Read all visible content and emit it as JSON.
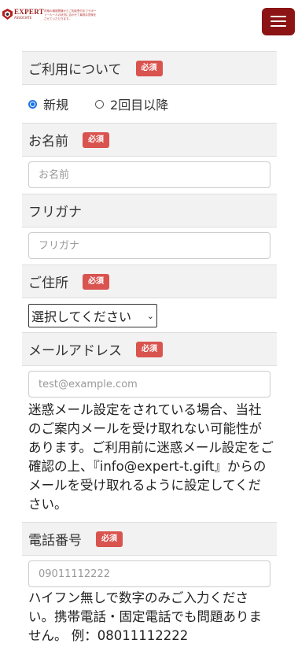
{
  "header": {
    "brand": "EXPERT",
    "brand_sub": "ASSOCIATE",
    "tagline": "資格の講座開講からご相談受付までサポート一人一人の状況に合わせて最適な提案をさせていただきます。",
    "menu_icon": "hamburger-icon",
    "accent_color": "#8c1414"
  },
  "form": {
    "required_label": "必須",
    "usage": {
      "label": "ご利用について",
      "options": [
        "新規",
        "2回目以降"
      ],
      "selected": "新規"
    },
    "name": {
      "label": "お名前",
      "placeholder": "お名前"
    },
    "furigana": {
      "label": "フリガナ",
      "placeholder": "フリガナ"
    },
    "address": {
      "label": "ご住所",
      "select_value": "選択してください"
    },
    "email": {
      "label": "メールアドレス",
      "placeholder": "test@example.com",
      "note": "迷惑メール設定をされている場合、当社のご案内メールを受け取れない可能性があります。ご利用前に迷惑メール設定をご確認の上、『info@expert-t.gift』からのメールを受け取れるように設定してください。"
    },
    "phone": {
      "label": "電話番号",
      "placeholder": "09011112222",
      "note": "ハイフン無しで数字のみご入力ください。携帯電話・固定電話でも問題ありません。 例：08011112222"
    }
  }
}
